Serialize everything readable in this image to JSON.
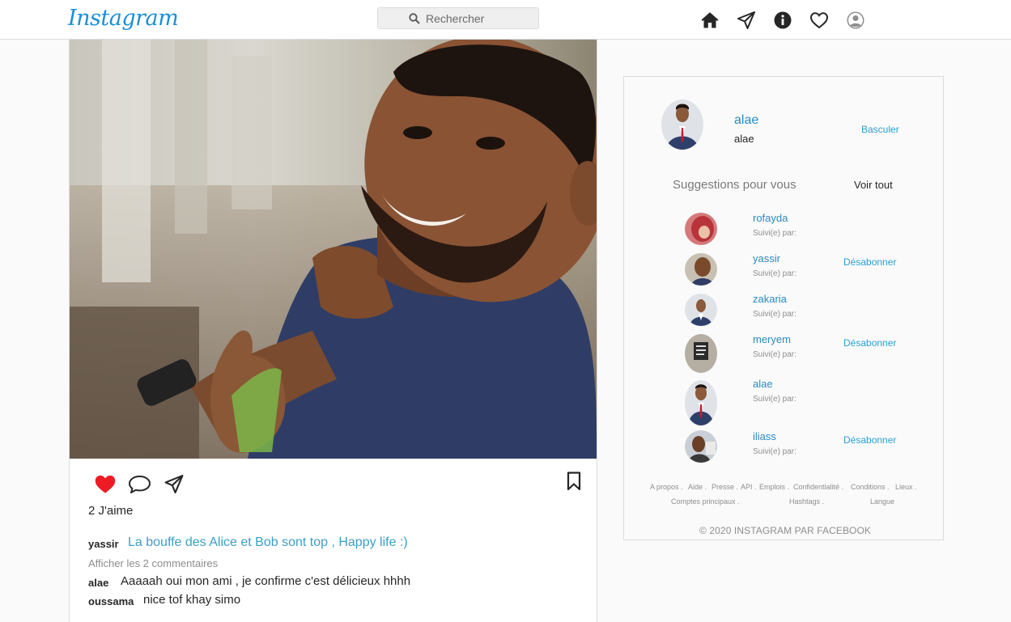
{
  "header": {
    "logo": "Instagram",
    "search_placeholder": "Rechercher",
    "icons": [
      "home-icon",
      "direct-icon",
      "info-icon",
      "heart-icon",
      "profile-icon"
    ]
  },
  "post": {
    "likes": "2 J'aime",
    "caption": {
      "user": "yassir",
      "text": "La bouffe des Alice et Bob sont top , Happy life :)"
    },
    "view_comments": "Afficher les 2 commentaires",
    "comments": [
      {
        "user": "alae",
        "text": "Aaaaah oui mon ami , je confirme c'est délicieux hhhh"
      },
      {
        "user": "oussama",
        "text": "nice tof khay simo"
      }
    ],
    "liked": true
  },
  "sidebar": {
    "me": {
      "username": "alae",
      "name": "alae"
    },
    "switch_label": "Basculer",
    "suggestions_title": "Suggestions pour vous",
    "see_all": "Voir tout",
    "suggestions": [
      {
        "name": "rofayda",
        "sub": "Suivi(e) par:",
        "action": ""
      },
      {
        "name": "yassir",
        "sub": "Suivi(e) par:",
        "action": "Désabonner"
      },
      {
        "name": "zakaria",
        "sub": "Suivi(e) par:",
        "action": ""
      },
      {
        "name": "meryem",
        "sub": "Suivi(e) par:",
        "action": "Désabonner"
      },
      {
        "name": "alae",
        "sub": "Suivi(e) par:",
        "action": ""
      },
      {
        "name": "iliass",
        "sub": "Suivi(e) par:",
        "action": "Désabonner"
      }
    ],
    "footer_row1": [
      "A propos .",
      "Aide .",
      "Presse .",
      "API .",
      "Emplois .",
      "Confidentialité .",
      "Conditions .",
      "Lieux ."
    ],
    "footer_row2": [
      "Comptes principaux .",
      "Hashtags .",
      "Langue"
    ],
    "copyright": "© 2020 INSTAGRAM PAR FACEBOOK"
  },
  "colors": {
    "link_blue": "#2b9fd1",
    "like_red": "#ed1c24",
    "logo_blue": "#1a8fd6"
  }
}
